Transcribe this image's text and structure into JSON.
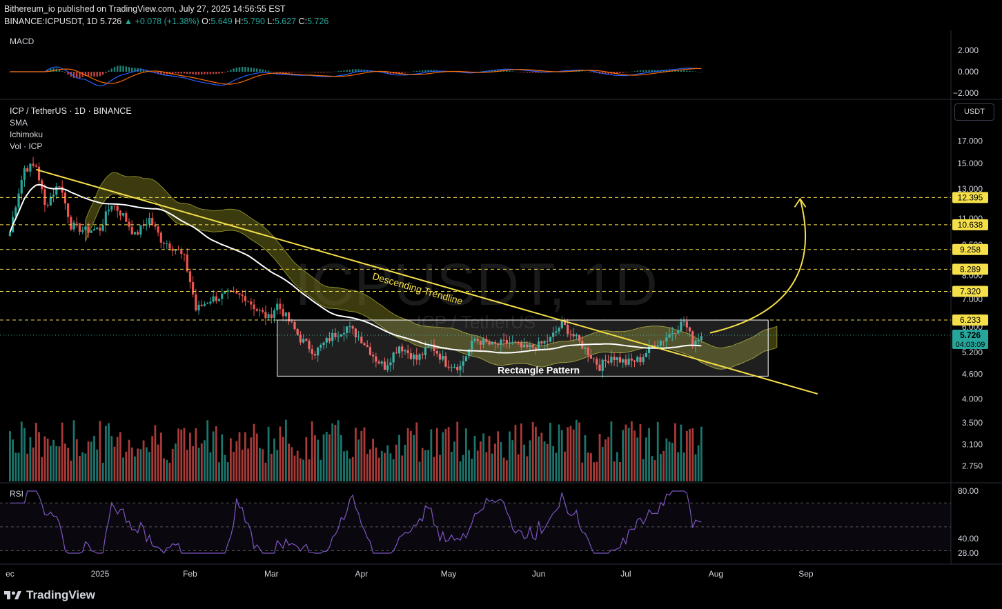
{
  "header": {
    "publisher_line": "Bithereum_io published on TradingView.com, July 27, 2025 14:56:55 EST",
    "symbol": "BINANCE:ICPUSDT, 1D",
    "last": "5.726",
    "change": "▲ +0.078 (+1.38%)",
    "o_label": "O:",
    "o": "5.649",
    "h_label": "H:",
    "h": "5.790",
    "l_label": "L:",
    "l": "5.627",
    "c_label": "C:",
    "c": "5.726"
  },
  "panes": {
    "macd_label": "MACD",
    "main_title": "ICP / TetherUS · 1D · BINANCE",
    "indicators": [
      "SMA",
      "Ichimoku",
      "Vol · ICP"
    ],
    "rsi_label": "RSI",
    "currency_button": "USDT"
  },
  "watermark": {
    "main": "ICPUSDT, 1D",
    "sub": "ICP / TetherUS"
  },
  "colors": {
    "up": "#26a69a",
    "down": "#ef5350",
    "trendline": "#f5e04a",
    "cloud": "#6b6b1c",
    "sma": "#ffffff",
    "rsi": "#7e57c2",
    "macd_line": "#2962ff",
    "signal_line": "#ff6d00",
    "price_tag": "#26a69a"
  },
  "chart_data": {
    "type": "candlestick",
    "symbol": "ICPUSDT",
    "interval": "1D",
    "price_scale": "log",
    "x_ticks": [
      "ec",
      "2025",
      "Feb",
      "Mar",
      "Apr",
      "May",
      "Jun",
      "Jul",
      "Aug",
      "Sep"
    ],
    "y_ticks": [
      "17.000",
      "15.000",
      "13.000",
      "11.000",
      "9.500",
      "8.000",
      "7.000",
      "6.000",
      "5.200",
      "4.600",
      "4.000",
      "3.500",
      "3.100",
      "2.750"
    ],
    "macd_ticks": [
      "2.000",
      "0.000",
      "−2.000"
    ],
    "rsi_ticks": [
      "80.00",
      "40.00",
      "28.00"
    ],
    "levels": [
      {
        "value": 12.395,
        "label": "12.395"
      },
      {
        "value": 10.638,
        "label": "10.638"
      },
      {
        "value": 9.258,
        "label": "9.258"
      },
      {
        "value": 8.289,
        "label": "8.289"
      },
      {
        "value": 7.32,
        "label": "7.320"
      },
      {
        "value": 6.233,
        "label": "6.233"
      }
    ],
    "last_price": {
      "value": 5.726,
      "label": "5.726",
      "countdown": "04:03:09"
    },
    "annotations": {
      "trendline": "Descending Trendline",
      "pattern": "Rectangle Pattern",
      "rectangle_top": 6.233,
      "rectangle_bottom": 4.55
    },
    "anchors": [
      [
        "2024-12-01",
        10.2
      ],
      [
        "2024-12-06",
        14.6
      ],
      [
        "2024-12-10",
        14.8
      ],
      [
        "2024-12-13",
        11.8
      ],
      [
        "2024-12-18",
        13.4
      ],
      [
        "2024-12-22",
        10.6
      ],
      [
        "2024-12-27",
        10.3
      ],
      [
        "2025-01-01",
        10.4
      ],
      [
        "2025-01-05",
        12.0
      ],
      [
        "2025-01-09",
        11.2
      ],
      [
        "2025-01-13",
        10.0
      ],
      [
        "2025-01-18",
        11.0
      ],
      [
        "2025-01-22",
        9.8
      ],
      [
        "2025-01-27",
        9.3
      ],
      [
        "2025-01-30",
        8.8
      ],
      [
        "2025-02-02",
        7.2
      ],
      [
        "2025-02-03",
        6.6
      ],
      [
        "2025-02-08",
        7.0
      ],
      [
        "2025-02-14",
        7.2
      ],
      [
        "2025-02-20",
        7.1
      ],
      [
        "2025-02-24",
        6.6
      ],
      [
        "2025-02-28",
        6.3
      ],
      [
        "2025-03-03",
        6.8
      ],
      [
        "2025-03-07",
        6.2
      ],
      [
        "2025-03-11",
        5.6
      ],
      [
        "2025-03-16",
        5.2
      ],
      [
        "2025-03-22",
        5.7
      ],
      [
        "2025-03-27",
        6.0
      ],
      [
        "2025-04-01",
        5.6
      ],
      [
        "2025-04-06",
        5.0
      ],
      [
        "2025-04-09",
        4.8
      ],
      [
        "2025-04-14",
        5.4
      ],
      [
        "2025-04-20",
        5.0
      ],
      [
        "2025-04-25",
        5.4
      ],
      [
        "2025-04-30",
        4.9
      ],
      [
        "2025-05-05",
        4.8
      ],
      [
        "2025-05-10",
        5.6
      ],
      [
        "2025-05-16",
        5.4
      ],
      [
        "2025-05-22",
        5.5
      ],
      [
        "2025-05-27",
        5.3
      ],
      [
        "2025-06-01",
        5.4
      ],
      [
        "2025-06-05",
        5.6
      ],
      [
        "2025-06-09",
        6.1
      ],
      [
        "2025-06-12",
        5.8
      ],
      [
        "2025-06-17",
        5.3
      ],
      [
        "2025-06-22",
        4.8
      ],
      [
        "2025-06-26",
        5.1
      ],
      [
        "2025-07-01",
        4.9
      ],
      [
        "2025-07-06",
        5.0
      ],
      [
        "2025-07-10",
        5.4
      ],
      [
        "2025-07-14",
        5.6
      ],
      [
        "2025-07-19",
        6.0
      ],
      [
        "2025-07-21",
        6.2
      ],
      [
        "2025-07-24",
        5.5
      ],
      [
        "2025-07-27",
        5.726
      ]
    ]
  }
}
